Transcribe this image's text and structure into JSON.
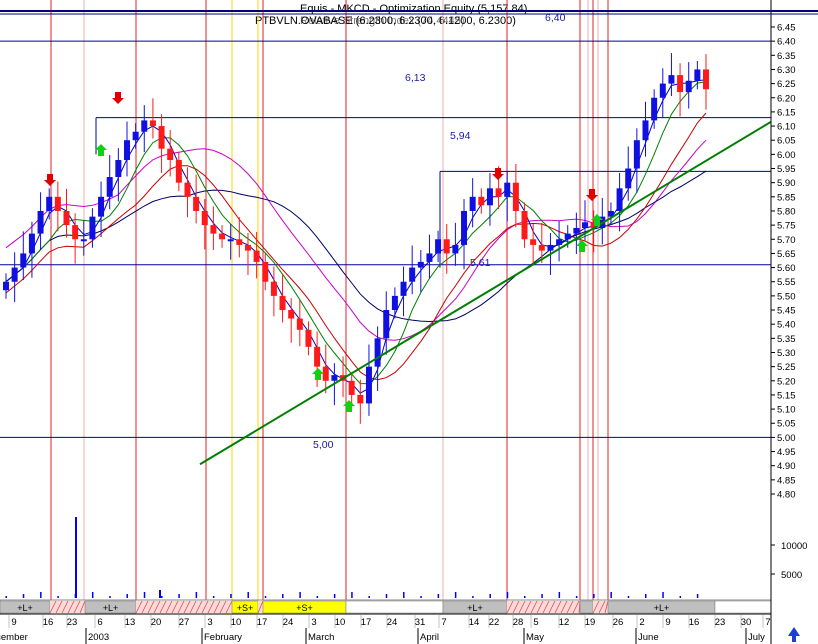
{
  "header": {
    "line1": "Equis - MKCD - Optimization Equity (5,157.84)",
    "line2": "PTBVLN.OVABASE (6.2300, 6.2300, 6.1200, 6.2300)",
    "line3": "Relative Strength Index (74.4445)"
  },
  "colors": {
    "up_candle": "#1010e0",
    "down_candle": "#ff1a1a",
    "ma_fast": "#0000cc",
    "ma_mid": "#008000",
    "ma_slow": "#cc0000",
    "ma_long": "#000066",
    "envelope": "#cc00cc",
    "trendline": "#008000",
    "levels": "#0000a0",
    "volume": "#0000ff",
    "background": "#ffffff"
  },
  "chart_data": {
    "type": "candlestick",
    "title": "",
    "ylim": [
      4.75,
      6.5
    ],
    "y_ticks": [
      6.45,
      6.4,
      6.35,
      6.3,
      6.25,
      6.2,
      6.15,
      6.1,
      6.05,
      6.0,
      5.95,
      5.9,
      5.85,
      5.8,
      5.75,
      5.7,
      5.65,
      5.6,
      5.55,
      5.5,
      5.45,
      5.4,
      5.35,
      5.3,
      5.25,
      5.2,
      5.15,
      5.1,
      5.05,
      5.0,
      4.95,
      4.9,
      4.85,
      4.8
    ],
    "y_tick_labels": [
      "6.45",
      "6.40",
      "6.35",
      "6.30",
      "6.25",
      "6.20",
      "6.15",
      "6.10",
      "6.05",
      "6.00",
      "5.95",
      "5.90",
      "5.85",
      "5.80",
      "5.75",
      "5.70",
      "5.65",
      "5.60",
      "5.55",
      "5.50",
      "5.45",
      "5.40",
      "5.35",
      "5.30",
      "5.25",
      "5.20",
      "5.15",
      "5.10",
      "5.05",
      "5.00",
      "4.95",
      "4.90",
      "4.85",
      "4.80"
    ],
    "volume_ticks": [
      10000,
      5000
    ],
    "volume_tick_labels": [
      "10000",
      "5000"
    ],
    "x_day_labels": [
      "9",
      "16",
      "23",
      "6",
      "13",
      "20",
      "27",
      "3",
      "10",
      "17",
      "24",
      "3",
      "10",
      "17",
      "24",
      "31",
      "7",
      "14",
      "22",
      "28",
      "5",
      "12",
      "19",
      "26",
      "2",
      "9",
      "16",
      "23",
      "30",
      "7"
    ],
    "x_month_labels": [
      "December",
      "2003",
      "February",
      "March",
      "April",
      "May",
      "June",
      "July"
    ],
    "level_labels": [
      "6,40",
      "6,13",
      "5,94",
      "5,61",
      "5,00"
    ],
    "level_values": [
      6.4,
      6.13,
      5.94,
      5.61,
      5.0
    ],
    "band_labels": [
      "+L+",
      "+L+",
      "+S+",
      "+S+",
      "+L+",
      "+L+"
    ],
    "trendline": {
      "from": [
        4.905
      ],
      "to": [
        6.115
      ]
    },
    "closes": [
      5.55,
      5.6,
      5.65,
      5.72,
      5.8,
      5.85,
      5.8,
      5.75,
      5.7,
      5.7,
      5.78,
      5.85,
      5.92,
      5.98,
      6.05,
      6.08,
      6.12,
      6.1,
      6.02,
      5.98,
      5.9,
      5.85,
      5.8,
      5.75,
      5.72,
      5.7,
      5.7,
      5.68,
      5.66,
      5.62,
      5.55,
      5.5,
      5.45,
      5.42,
      5.38,
      5.32,
      5.25,
      5.2,
      5.22,
      5.2,
      5.15,
      5.12,
      5.25,
      5.35,
      5.45,
      5.5,
      5.55,
      5.6,
      5.62,
      5.65,
      5.7,
      5.65,
      5.68,
      5.8,
      5.85,
      5.82,
      5.88,
      5.85,
      5.9,
      5.8,
      5.7,
      5.68,
      5.66,
      5.68,
      5.7,
      5.72,
      5.74,
      5.76,
      5.74,
      5.78,
      5.8,
      5.88,
      5.95,
      6.05,
      6.12,
      6.2,
      6.25,
      6.28,
      6.22,
      6.26,
      6.3,
      6.23
    ],
    "series": [
      {
        "name": "",
        "values": "closes"
      }
    ]
  }
}
